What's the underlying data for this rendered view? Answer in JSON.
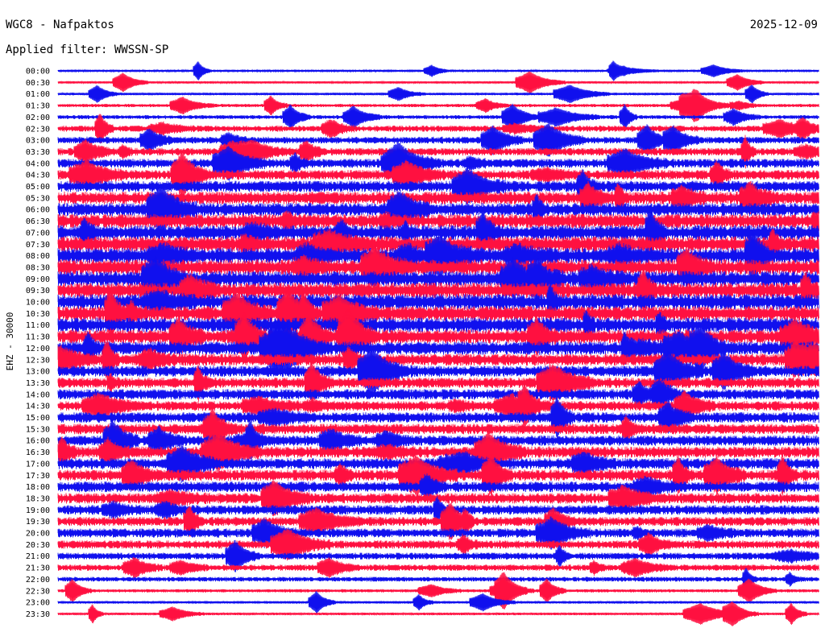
{
  "header": {
    "station": "WGC8 - Nafpaktos",
    "date": "2025-12-09",
    "filter": "Applied filter: WWSSN-SP"
  },
  "channel_label": "EHZ - 30000",
  "colors": {
    "trace_a": "#1010ee",
    "trace_b": "#ff1040",
    "text": "#000000",
    "background": "#ffffff"
  },
  "chart_data": {
    "type": "line",
    "title": "",
    "xlabel": "",
    "ylabel": "EHZ - 30000",
    "rows": [
      {
        "label": "00:00",
        "activity": 0.05,
        "color": "trace_a"
      },
      {
        "label": "00:30",
        "activity": 0.08,
        "color": "trace_b"
      },
      {
        "label": "01:00",
        "activity": 0.1,
        "color": "trace_a"
      },
      {
        "label": "01:30",
        "activity": 0.15,
        "color": "trace_b"
      },
      {
        "label": "02:00",
        "activity": 0.2,
        "color": "trace_a"
      },
      {
        "label": "02:30",
        "activity": 0.35,
        "color": "trace_b"
      },
      {
        "label": "03:00",
        "activity": 0.4,
        "color": "trace_a"
      },
      {
        "label": "03:30",
        "activity": 0.45,
        "color": "trace_b"
      },
      {
        "label": "04:00",
        "activity": 0.55,
        "color": "trace_a"
      },
      {
        "label": "04:30",
        "activity": 0.6,
        "color": "trace_b"
      },
      {
        "label": "05:00",
        "activity": 0.7,
        "color": "trace_a"
      },
      {
        "label": "05:30",
        "activity": 0.8,
        "color": "trace_b"
      },
      {
        "label": "06:00",
        "activity": 0.85,
        "color": "trace_a"
      },
      {
        "label": "06:30",
        "activity": 0.9,
        "color": "trace_b"
      },
      {
        "label": "07:00",
        "activity": 0.95,
        "color": "trace_a"
      },
      {
        "label": "07:30",
        "activity": 1.0,
        "color": "trace_b"
      },
      {
        "label": "08:00",
        "activity": 1.0,
        "color": "trace_a"
      },
      {
        "label": "08:30",
        "activity": 1.0,
        "color": "trace_b"
      },
      {
        "label": "09:00",
        "activity": 1.0,
        "color": "trace_a"
      },
      {
        "label": "09:30",
        "activity": 1.0,
        "color": "trace_b"
      },
      {
        "label": "10:00",
        "activity": 1.0,
        "color": "trace_a"
      },
      {
        "label": "10:30",
        "activity": 0.95,
        "color": "trace_b"
      },
      {
        "label": "11:00",
        "activity": 0.95,
        "color": "trace_a"
      },
      {
        "label": "11:30",
        "activity": 0.9,
        "color": "trace_b"
      },
      {
        "label": "12:00",
        "activity": 0.85,
        "color": "trace_a"
      },
      {
        "label": "12:30",
        "activity": 0.75,
        "color": "trace_b"
      },
      {
        "label": "13:00",
        "activity": 0.7,
        "color": "trace_a"
      },
      {
        "label": "13:30",
        "activity": 0.65,
        "color": "trace_b"
      },
      {
        "label": "14:00",
        "activity": 0.65,
        "color": "trace_a"
      },
      {
        "label": "14:30",
        "activity": 0.6,
        "color": "trace_b"
      },
      {
        "label": "15:00",
        "activity": 0.65,
        "color": "trace_a"
      },
      {
        "label": "15:30",
        "activity": 0.65,
        "color": "trace_b"
      },
      {
        "label": "16:00",
        "activity": 0.65,
        "color": "trace_a"
      },
      {
        "label": "16:30",
        "activity": 0.7,
        "color": "trace_b"
      },
      {
        "label": "17:00",
        "activity": 0.7,
        "color": "trace_a"
      },
      {
        "label": "17:30",
        "activity": 0.7,
        "color": "trace_b"
      },
      {
        "label": "18:00",
        "activity": 0.65,
        "color": "trace_a"
      },
      {
        "label": "18:30",
        "activity": 0.65,
        "color": "trace_b"
      },
      {
        "label": "19:00",
        "activity": 0.6,
        "color": "trace_a"
      },
      {
        "label": "19:30",
        "activity": 0.55,
        "color": "trace_b"
      },
      {
        "label": "20:00",
        "activity": 0.55,
        "color": "trace_a"
      },
      {
        "label": "20:30",
        "activity": 0.5,
        "color": "trace_b"
      },
      {
        "label": "21:00",
        "activity": 0.4,
        "color": "trace_a"
      },
      {
        "label": "21:30",
        "activity": 0.35,
        "color": "trace_b"
      },
      {
        "label": "22:00",
        "activity": 0.25,
        "color": "trace_a"
      },
      {
        "label": "22:30",
        "activity": 0.15,
        "color": "trace_b"
      },
      {
        "label": "23:00",
        "activity": 0.1,
        "color": "trace_a"
      },
      {
        "label": "23:30",
        "activity": 0.1,
        "color": "trace_b"
      }
    ]
  }
}
